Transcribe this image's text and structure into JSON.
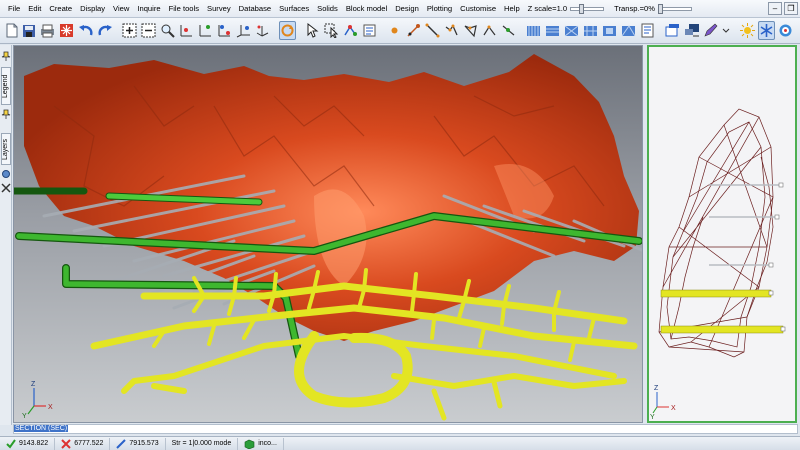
{
  "menu": {
    "items": [
      "File",
      "Edit",
      "Create",
      "Display",
      "View",
      "Inquire",
      "File tools",
      "Survey",
      "Database",
      "Surfaces",
      "Solids",
      "Block model",
      "Design",
      "Plotting",
      "Customise",
      "Help"
    ],
    "z_scale_label": "Z scale=1.0",
    "transparency_label": "Transp.=0%"
  },
  "dock": {
    "legend_tab": "Legend",
    "layers_tab": "Layers"
  },
  "main_view": {
    "axis_z": "Z",
    "axis_y": "Y",
    "axis_x": "X"
  },
  "side_view": {
    "axis_z": "Z",
    "axis_x": "X",
    "axis_y": "Y"
  },
  "command_line": {
    "text": "SECTION (SEC)"
  },
  "status": {
    "coord1": "9143.822",
    "coord2": "6777.522",
    "coord3": "7915.573",
    "mode": "Str = 1|0.000 mode",
    "extra": "inco..."
  },
  "colors": {
    "orebody": "#c8401c",
    "drives": "#d9db1e",
    "pipes": "#2f9b25",
    "rods": "#9aa1a8",
    "sideview_border": "#4caf50"
  }
}
